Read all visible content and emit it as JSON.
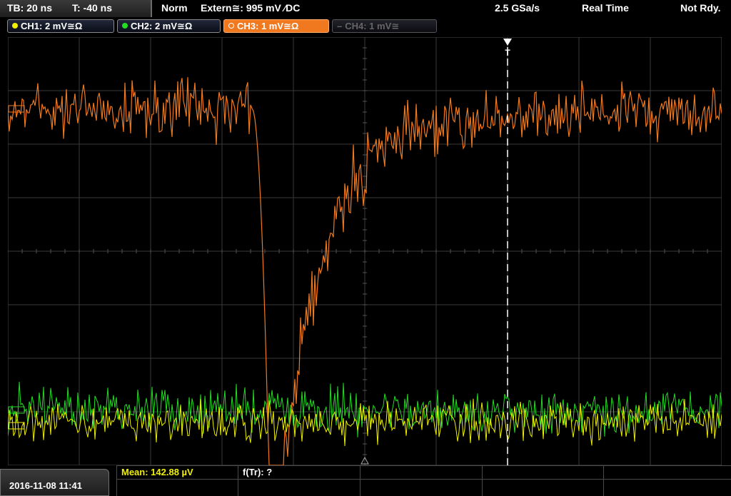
{
  "topbar": {
    "timebase": "TB: 20 ns",
    "trigger_offset": "T: -40 ns",
    "trigger_mode": "Norm",
    "trigger_source": "Extern≅: 995 mV ⁄DC",
    "sample_rate": "2.5 GSa/s",
    "acq_mode": "Real Time",
    "status": "Not Rdy."
  },
  "channels": [
    {
      "label": "CH1: 2 mV≅Ω",
      "color": "#f0f000"
    },
    {
      "label": "CH2: 2 mV≅Ω",
      "color": "#22dd22"
    },
    {
      "label": "CH3: 1 mV≅Ω",
      "color": "#f0781e"
    },
    {
      "label": "CH4: 1 mV≅",
      "color": "#777777"
    }
  ],
  "trigger_marker": "T",
  "bottom": {
    "datetime": "2016-11-08 11:41",
    "mean": "Mean: 142.88 µV",
    "ftr": "f(Tr): ?"
  },
  "colors": {
    "ch1": "#f0f000",
    "ch2": "#22dd22",
    "ch3": "#f0781e",
    "grid": "#3a3a3a"
  }
}
